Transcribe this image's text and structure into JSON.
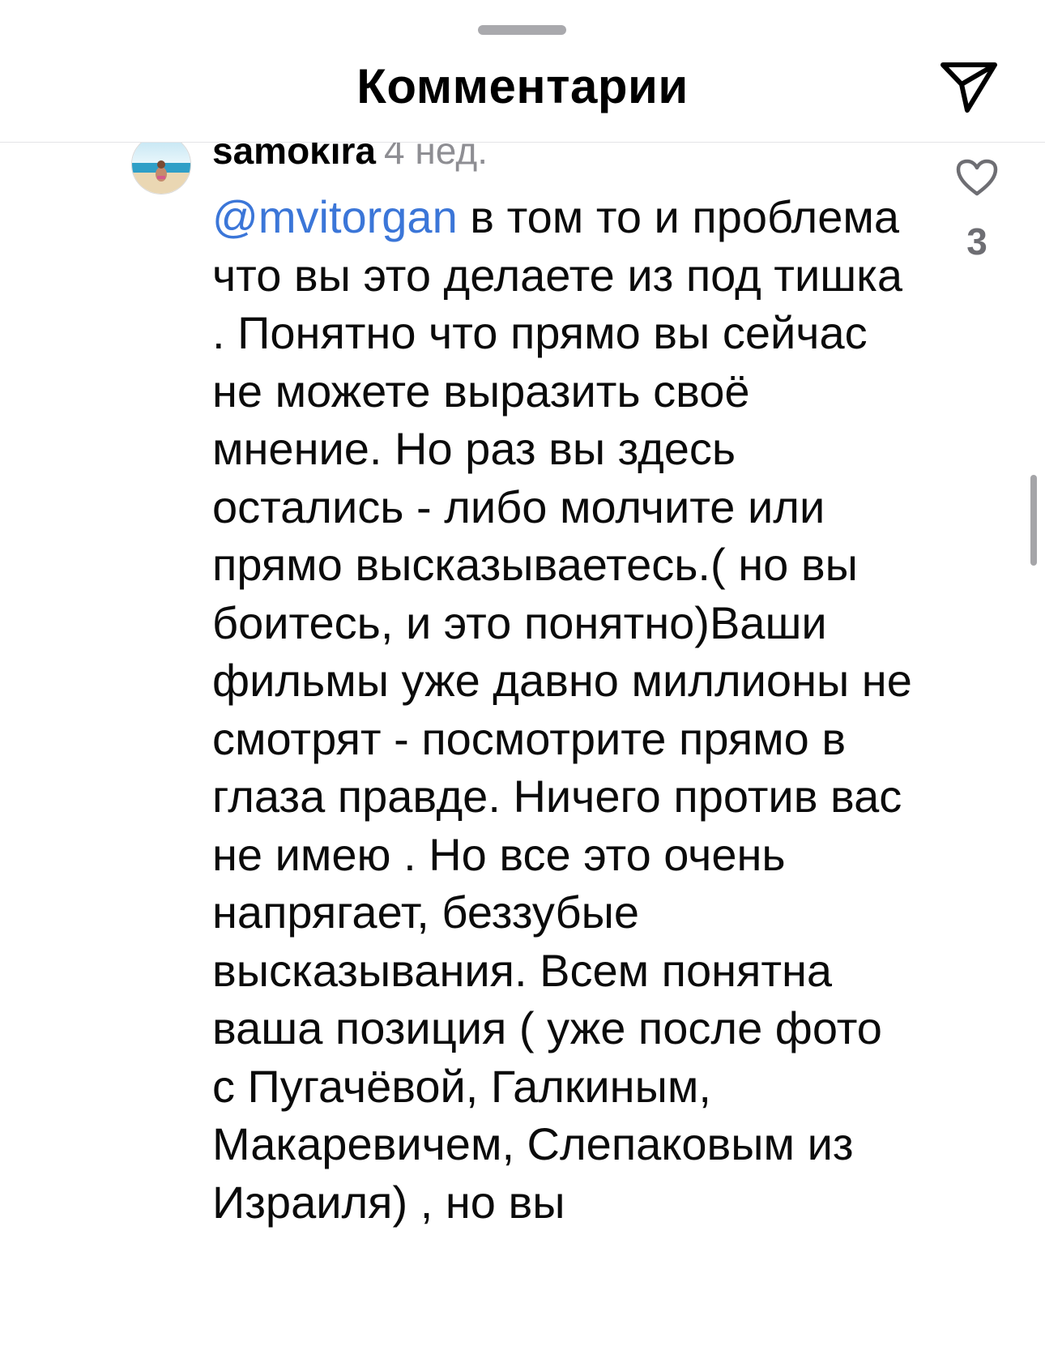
{
  "header": {
    "title": "Комментарии",
    "share_icon": "paper-plane-icon"
  },
  "comment": {
    "avatar_icon": "avatar-beach-photo",
    "username": "samokira",
    "time": "4 нед.",
    "mention": "@mvitorgan",
    "text": " в том то и проблема что вы это делаете из под тишка . Понятно что прямо вы сейчас не можете выразить своё мнение. Но раз вы здесь остались - либо молчите или прямо высказываетесь.( но вы боитесь, и это понятно)Ваши фильмы уже давно миллионы не смотрят - посмотрите прямо в глаза правде. Ничего против вас не имею . Но все это очень напрягает, беззубые высказывания. Всем понятна ваша позиция ( уже после фото с Пугачёвой, Галкиным, Макаревичем, Слепаковым из Израиля) , но вы",
    "like_icon": "heart-outline-icon",
    "like_count": "3"
  },
  "colors": {
    "mention": "#3b76d8",
    "muted": "#8e8e93",
    "divider": "#e4e4e7"
  }
}
